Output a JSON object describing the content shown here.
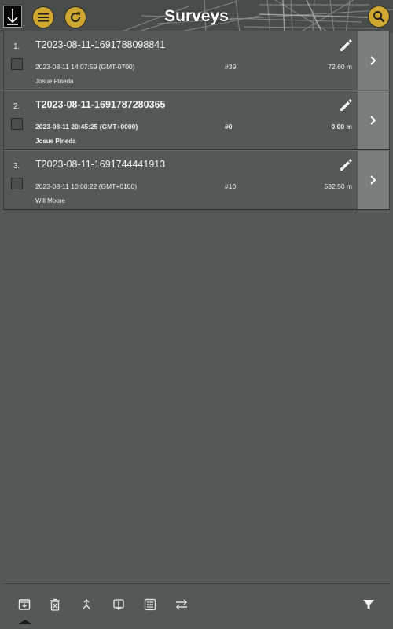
{
  "header": {
    "title": "Surveys",
    "logo_icon": "download-arrow-logo-icon",
    "menu_icon": "hamburger-menu-icon",
    "refresh_icon": "refresh-icon",
    "search_icon": "search-icon",
    "accent": "#cfa730"
  },
  "surveys": [
    {
      "index": "1.",
      "name": "T2023-08-11-1691788098841",
      "datetime": "2023-08-11 14:07:59 (GMT-0700)",
      "count": "#39",
      "distance": "72.60 m",
      "author": "Josue Pineda",
      "bold": false,
      "checked": false
    },
    {
      "index": "2.",
      "name": "T2023-08-11-1691787280365",
      "datetime": "2023-08-11 20:45:25 (GMT+0000)",
      "count": "#0",
      "distance": "0.00 m",
      "author": "Josue Pineda",
      "bold": true,
      "checked": false
    },
    {
      "index": "3.",
      "name": "T2023-08-11-1691744441913",
      "datetime": "2023-08-11 10:00:22 (GMT+0100)",
      "count": "#10",
      "distance": "532.50 m",
      "author": "Will Moore",
      "bold": false,
      "checked": false
    }
  ],
  "toolbar": {
    "icons": [
      "archive-icon",
      "delete-icon",
      "merge-icon",
      "import-icon",
      "list-icon",
      "swap-icon",
      "filter-icon"
    ]
  }
}
